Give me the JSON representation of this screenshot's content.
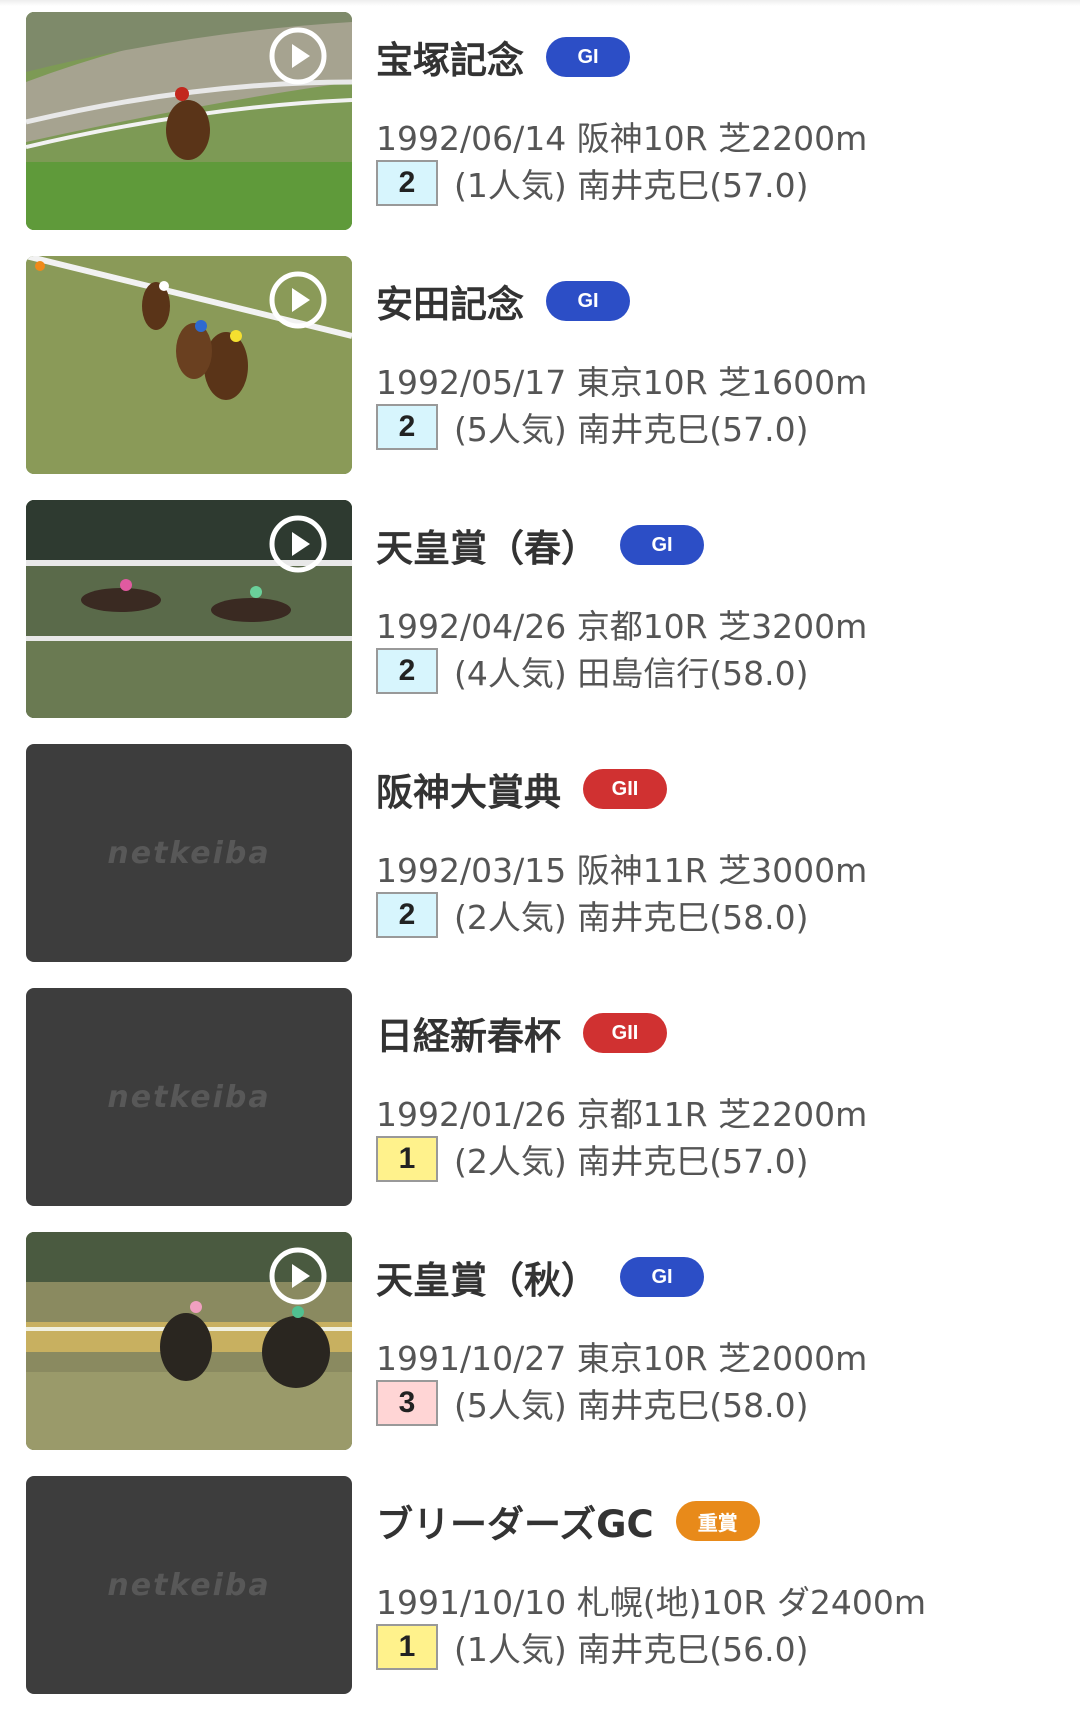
{
  "colors": {
    "grade_GI": "#2c4ec6",
    "grade_GII": "#d03131",
    "grade_jusho": "#e88a1a",
    "pos_1": "#fff28c",
    "pos_2": "#d7f5fd",
    "pos_3": "#ffd5d5"
  },
  "races": [
    {
      "title": "宝塚記念",
      "grade": "GI",
      "grade_color": "#2c4ec6",
      "meta": "1992/06/14 阪神10R 芝2200m",
      "position": "2",
      "position_color": "#d7f5fd",
      "detail": "(1人気) 南井克巳(57.0)",
      "thumbnail": "video",
      "icon": "play-icon"
    },
    {
      "title": "安田記念",
      "grade": "GI",
      "grade_color": "#2c4ec6",
      "meta": "1992/05/17 東京10R 芝1600m",
      "position": "2",
      "position_color": "#d7f5fd",
      "detail": "(5人気) 南井克巳(57.0)",
      "thumbnail": "video",
      "icon": "play-icon"
    },
    {
      "title": "天皇賞（春）",
      "grade": "GI",
      "grade_color": "#2c4ec6",
      "meta": "1992/04/26 京都10R 芝3200m",
      "position": "2",
      "position_color": "#d7f5fd",
      "detail": "(4人気) 田島信行(58.0)",
      "thumbnail": "video",
      "icon": "play-icon"
    },
    {
      "title": "阪神大賞典",
      "grade": "GII",
      "grade_color": "#d03131",
      "meta": "1992/03/15 阪神11R 芝3000m",
      "position": "2",
      "position_color": "#d7f5fd",
      "detail": "(2人気) 南井克巳(58.0)",
      "thumbnail": "placeholder",
      "logo_text": "netkeiba"
    },
    {
      "title": "日経新春杯",
      "grade": "GII",
      "grade_color": "#d03131",
      "meta": "1992/01/26 京都11R 芝2200m",
      "position": "1",
      "position_color": "#fff28c",
      "detail": "(2人気) 南井克巳(57.0)",
      "thumbnail": "placeholder",
      "logo_text": "netkeiba"
    },
    {
      "title": "天皇賞（秋）",
      "grade": "GI",
      "grade_color": "#2c4ec6",
      "meta": "1991/10/27 東京10R 芝2000m",
      "position": "3",
      "position_color": "#ffd5d5",
      "detail": "(5人気) 南井克巳(58.0)",
      "thumbnail": "video",
      "icon": "play-icon"
    },
    {
      "title": "ブリーダーズGC",
      "grade": "重賞",
      "grade_color": "#e88a1a",
      "meta": "1991/10/10 札幌(地)10R ダ2400m",
      "position": "1",
      "position_color": "#fff28c",
      "detail": "(1人気) 南井克巳(56.0)",
      "thumbnail": "placeholder",
      "logo_text": "netkeiba"
    }
  ]
}
